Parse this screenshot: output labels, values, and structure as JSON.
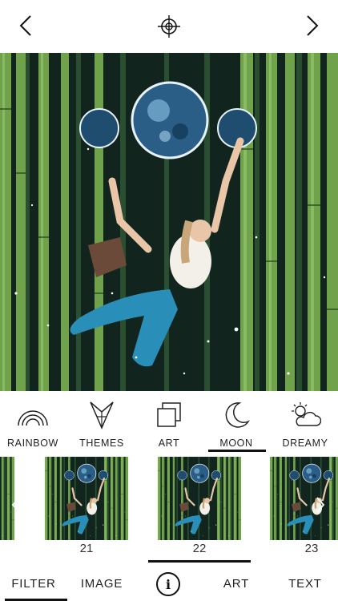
{
  "header": {
    "back_icon": "chevron-left-icon",
    "center_icon": "crosshair-icon",
    "forward_icon": "chevron-right-icon"
  },
  "categories": [
    {
      "label": "RAINBOW",
      "icon": "rainbow-icon"
    },
    {
      "label": "THEMES",
      "icon": "origami-bird-icon"
    },
    {
      "label": "ART",
      "icon": "layers-icon"
    },
    {
      "label": "MOON",
      "icon": "crescent-moon-icon",
      "selected": true
    },
    {
      "label": "DREAMY",
      "icon": "sun-cloud-icon"
    }
  ],
  "thumbnails": [
    {
      "number": "21"
    },
    {
      "number": "22",
      "selected": true
    },
    {
      "number": "23"
    }
  ],
  "bottom_tabs": [
    {
      "label": "FILTER",
      "selected": true
    },
    {
      "label": "IMAGE"
    },
    {
      "label": "ART"
    },
    {
      "label": "TEXT"
    }
  ],
  "colors": {
    "accent": "#111111",
    "bamboo_green": "#6fa24a",
    "night_sky": "#0d1a16",
    "moon_blue": "#3b7fa8",
    "tail_teal": "#2a8fb8"
  }
}
